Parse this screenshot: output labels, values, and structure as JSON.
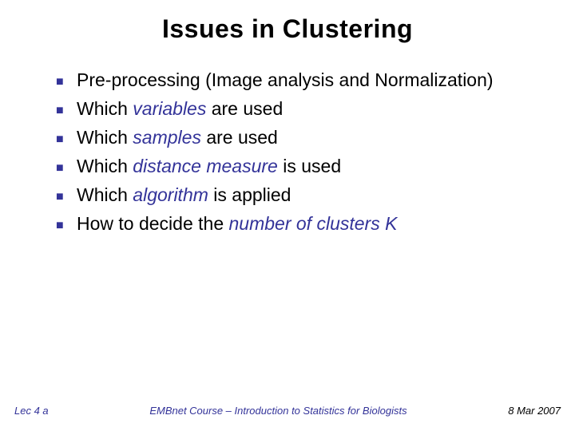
{
  "title": "Issues in Clustering",
  "bullets": [
    {
      "pre": "Pre-processing (Image analysis and Normalization)",
      "em": "",
      "post": ""
    },
    {
      "pre": "Which ",
      "em": "variables",
      "post": " are used"
    },
    {
      "pre": "Which ",
      "em": "samples",
      "post": " are used"
    },
    {
      "pre": "Which ",
      "em": "distance measure",
      "post": " is used"
    },
    {
      "pre": "Which ",
      "em": "algorithm",
      "post": " is applied"
    },
    {
      "pre": "How to decide the ",
      "em": "number of clusters K",
      "post": ""
    }
  ],
  "footer": {
    "left": "Lec 4 a",
    "center": "EMBnet Course – Introduction to Statistics for Biologists",
    "right": "8 Mar 2007"
  }
}
